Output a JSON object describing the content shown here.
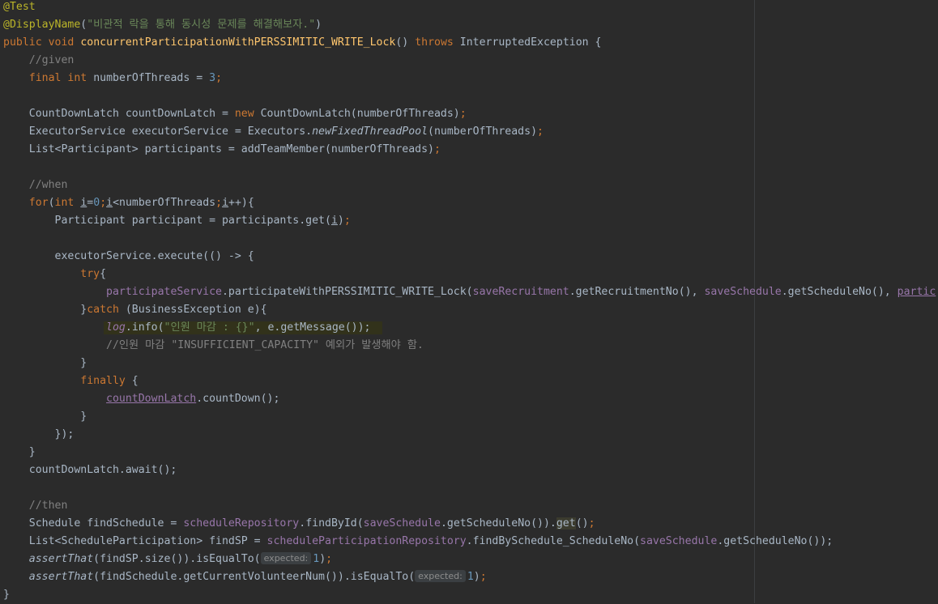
{
  "editor": {
    "annotation_test": "@Test",
    "annotation_display": "@DisplayName",
    "display_name_arg": "\"비관적 락을 통해 동시성 문제를 해결해보자.\"",
    "kw_public": "public",
    "kw_void": "void",
    "method_name": "concurrentParticipationWithPERSSIMITIC_WRITE_Lock",
    "kw_throws": "throws",
    "exception_type": "InterruptedException",
    "comment_given": "//given",
    "kw_final": "final",
    "kw_int": "int",
    "threads_var": "numberOfThreads = ",
    "threads_value": "3",
    "latch_decl": "CountDownLatch countDownLatch = ",
    "kw_new": "new",
    "latch_ctor": " CountDownLatch(numberOfThreads)",
    "executor_decl": "ExecutorService executorService = Executors.",
    "executor_factory": "newFixedThreadPool",
    "executor_args": "(numberOfThreads)",
    "participants_decl": "List<Participant> participants = addTeamMember(numberOfThreads)",
    "comment_when": "//when",
    "kw_for": "for",
    "loop_var": "i",
    "loop_start": "0",
    "loop_cond": "<numberOfThreads",
    "loop_inc": "++){",
    "participant_decl": "Participant participant = participants.get(",
    "execute_call": "executorService.execute(() -> {",
    "kw_try": "try",
    "participate_service": "participateService",
    "participate_method": ".participateWithPERSSIMITIC_WRITE_Lock(",
    "save_recruitment": "saveRecruitment",
    "get_recruitment_no": ".getRecruitmentNo(), ",
    "save_schedule": "saveSchedule",
    "get_schedule_no": ".getScheduleNo(), ",
    "partic_overflow": "partic",
    "kw_catch": "catch",
    "catch_params": " (BusinessException e){",
    "log_field": "log",
    "log_info": ".info(",
    "log_message": "\"인원 마감 : {}\"",
    "log_args": ", e.getMessage());",
    "comment_exception": "//인원 마감 \"INSUFFICIENT_CAPACITY\" 예외가 발생해야 함.",
    "kw_finally": "finally",
    "latch_field": "countDownLatch",
    "count_down": ".countDown();",
    "close_lambda": "});",
    "await_call": "countDownLatch.await();",
    "comment_then": "//then",
    "find_schedule_decl": "Schedule findSchedule = ",
    "schedule_repo": "scheduleRepository",
    "find_by_id": ".findById(",
    "get_schedule_no_close": ".getScheduleNo()).",
    "get_call": "get",
    "find_sp_decl": "List<ScheduleParticipation> findSP = ",
    "schedule_part_repo": "scheduleParticipationRepository",
    "find_by_schedule": ".findBySchedule_ScheduleNo(",
    "get_schedule_no_end": ".getScheduleNo());",
    "assert_that": "assertThat",
    "assert1_arg": "(findSP.size()).isEqualTo(",
    "assert2_arg": "(findSchedule.getCurrentVolunteerNum()).isEqualTo(",
    "hint_expected": "expected:",
    "expected_value": "1",
    "close_brace": "}"
  }
}
